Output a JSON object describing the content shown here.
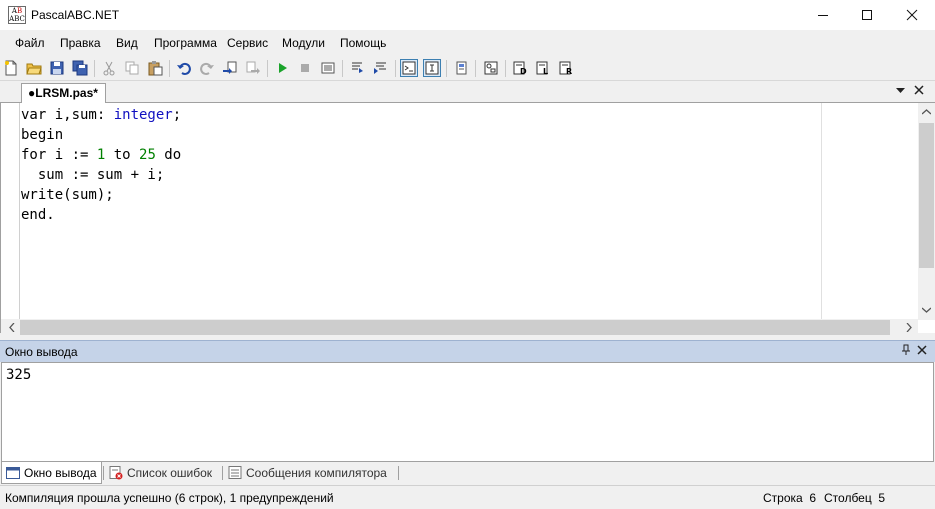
{
  "window": {
    "title": "PascalABC.NET",
    "min_icon": "minimize-icon",
    "max_icon": "maximize-icon",
    "close_icon": "close-icon"
  },
  "menu": {
    "items": [
      "Файл",
      "Правка",
      "Вид",
      "Программа",
      "Сервис",
      "Модули",
      "Помощь"
    ]
  },
  "toolbar": {
    "icons": [
      "new-file-icon",
      "open-folder-icon",
      "save-icon",
      "save-all-icon",
      "cut-icon",
      "copy-icon",
      "paste-icon",
      "undo-icon",
      "redo-icon",
      "navigate-back-icon",
      "navigate-forward-icon",
      "run-icon",
      "stop-icon",
      "compile-icon",
      "debug-step-icon",
      "debug-step-over-icon",
      "output-window-icon",
      "form-designer-icon",
      "compiler-options-icon",
      "code-template-icon",
      "doc-gen-icon",
      "text-format-icon",
      "refactor-icon"
    ]
  },
  "tab": {
    "label": "●LRSM.pas*",
    "dropdown_icon": "chevron-down-icon",
    "close_icon": "close-icon"
  },
  "editor": {
    "lines": [
      [
        {
          "t": "var i,sum: ",
          "c": ""
        },
        {
          "t": "integer",
          "c": "kw-type"
        },
        {
          "t": ";",
          "c": ""
        }
      ],
      [
        {
          "t": "begin",
          "c": ""
        }
      ],
      [
        {
          "t": "for i := ",
          "c": ""
        },
        {
          "t": "1",
          "c": "num"
        },
        {
          "t": " to ",
          "c": ""
        },
        {
          "t": "25",
          "c": "num"
        },
        {
          "t": " do",
          "c": ""
        }
      ],
      [
        {
          "t": "  sum := sum + i;",
          "c": ""
        }
      ],
      [
        {
          "t": "write(sum);",
          "c": ""
        }
      ],
      [
        {
          "t": "end.",
          "c": ""
        }
      ]
    ],
    "colors": {
      "type_keyword": "#1010c0",
      "number": "#008000"
    }
  },
  "output": {
    "title": "Окно вывода",
    "text": "325",
    "pin_icon": "pin-icon",
    "close_icon": "close-icon"
  },
  "bottom_tabs": [
    {
      "label": "Окно вывода",
      "icon": "output-window-icon",
      "active": true
    },
    {
      "label": "Список ошибок",
      "icon": "error-list-icon",
      "active": false
    },
    {
      "label": "Сообщения компилятора",
      "icon": "compiler-messages-icon",
      "active": false
    }
  ],
  "status": {
    "message": "Компиляция прошла успешно (6 строк), 1 предупреждений",
    "row_label": "Строка",
    "row_value": "6",
    "col_label": "Столбец",
    "col_value": "5"
  },
  "colors": {
    "output_header_bg": "#c5d3e8",
    "pressed_button_border": "#3c7fb1"
  }
}
